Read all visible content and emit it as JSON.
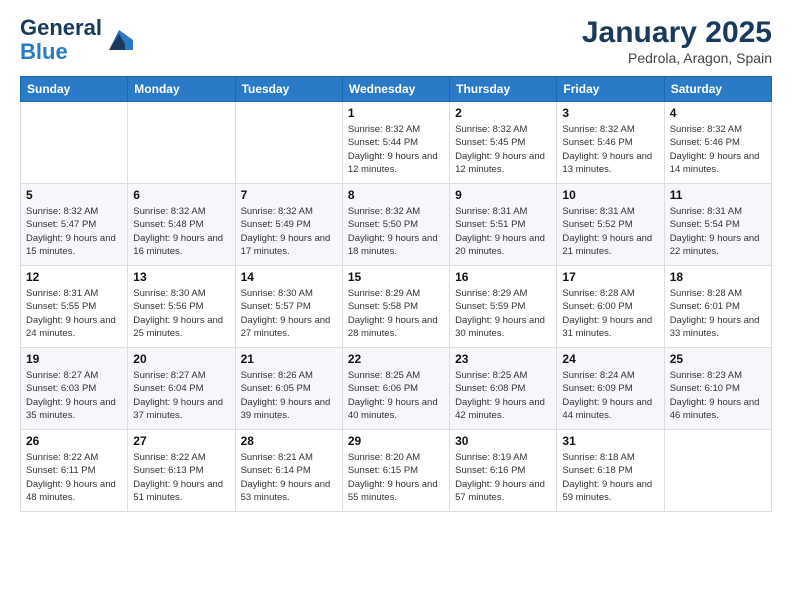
{
  "header": {
    "logo_general": "General",
    "logo_blue": "Blue",
    "month_title": "January 2025",
    "location": "Pedrola, Aragon, Spain"
  },
  "weekdays": [
    "Sunday",
    "Monday",
    "Tuesday",
    "Wednesday",
    "Thursday",
    "Friday",
    "Saturday"
  ],
  "weeks": [
    [
      {
        "day": "",
        "info": ""
      },
      {
        "day": "",
        "info": ""
      },
      {
        "day": "",
        "info": ""
      },
      {
        "day": "1",
        "info": "Sunrise: 8:32 AM\nSunset: 5:44 PM\nDaylight: 9 hours and 12 minutes."
      },
      {
        "day": "2",
        "info": "Sunrise: 8:32 AM\nSunset: 5:45 PM\nDaylight: 9 hours and 12 minutes."
      },
      {
        "day": "3",
        "info": "Sunrise: 8:32 AM\nSunset: 5:46 PM\nDaylight: 9 hours and 13 minutes."
      },
      {
        "day": "4",
        "info": "Sunrise: 8:32 AM\nSunset: 5:46 PM\nDaylight: 9 hours and 14 minutes."
      }
    ],
    [
      {
        "day": "5",
        "info": "Sunrise: 8:32 AM\nSunset: 5:47 PM\nDaylight: 9 hours and 15 minutes."
      },
      {
        "day": "6",
        "info": "Sunrise: 8:32 AM\nSunset: 5:48 PM\nDaylight: 9 hours and 16 minutes."
      },
      {
        "day": "7",
        "info": "Sunrise: 8:32 AM\nSunset: 5:49 PM\nDaylight: 9 hours and 17 minutes."
      },
      {
        "day": "8",
        "info": "Sunrise: 8:32 AM\nSunset: 5:50 PM\nDaylight: 9 hours and 18 minutes."
      },
      {
        "day": "9",
        "info": "Sunrise: 8:31 AM\nSunset: 5:51 PM\nDaylight: 9 hours and 20 minutes."
      },
      {
        "day": "10",
        "info": "Sunrise: 8:31 AM\nSunset: 5:52 PM\nDaylight: 9 hours and 21 minutes."
      },
      {
        "day": "11",
        "info": "Sunrise: 8:31 AM\nSunset: 5:54 PM\nDaylight: 9 hours and 22 minutes."
      }
    ],
    [
      {
        "day": "12",
        "info": "Sunrise: 8:31 AM\nSunset: 5:55 PM\nDaylight: 9 hours and 24 minutes."
      },
      {
        "day": "13",
        "info": "Sunrise: 8:30 AM\nSunset: 5:56 PM\nDaylight: 9 hours and 25 minutes."
      },
      {
        "day": "14",
        "info": "Sunrise: 8:30 AM\nSunset: 5:57 PM\nDaylight: 9 hours and 27 minutes."
      },
      {
        "day": "15",
        "info": "Sunrise: 8:29 AM\nSunset: 5:58 PM\nDaylight: 9 hours and 28 minutes."
      },
      {
        "day": "16",
        "info": "Sunrise: 8:29 AM\nSunset: 5:59 PM\nDaylight: 9 hours and 30 minutes."
      },
      {
        "day": "17",
        "info": "Sunrise: 8:28 AM\nSunset: 6:00 PM\nDaylight: 9 hours and 31 minutes."
      },
      {
        "day": "18",
        "info": "Sunrise: 8:28 AM\nSunset: 6:01 PM\nDaylight: 9 hours and 33 minutes."
      }
    ],
    [
      {
        "day": "19",
        "info": "Sunrise: 8:27 AM\nSunset: 6:03 PM\nDaylight: 9 hours and 35 minutes."
      },
      {
        "day": "20",
        "info": "Sunrise: 8:27 AM\nSunset: 6:04 PM\nDaylight: 9 hours and 37 minutes."
      },
      {
        "day": "21",
        "info": "Sunrise: 8:26 AM\nSunset: 6:05 PM\nDaylight: 9 hours and 39 minutes."
      },
      {
        "day": "22",
        "info": "Sunrise: 8:25 AM\nSunset: 6:06 PM\nDaylight: 9 hours and 40 minutes."
      },
      {
        "day": "23",
        "info": "Sunrise: 8:25 AM\nSunset: 6:08 PM\nDaylight: 9 hours and 42 minutes."
      },
      {
        "day": "24",
        "info": "Sunrise: 8:24 AM\nSunset: 6:09 PM\nDaylight: 9 hours and 44 minutes."
      },
      {
        "day": "25",
        "info": "Sunrise: 8:23 AM\nSunset: 6:10 PM\nDaylight: 9 hours and 46 minutes."
      }
    ],
    [
      {
        "day": "26",
        "info": "Sunrise: 8:22 AM\nSunset: 6:11 PM\nDaylight: 9 hours and 48 minutes."
      },
      {
        "day": "27",
        "info": "Sunrise: 8:22 AM\nSunset: 6:13 PM\nDaylight: 9 hours and 51 minutes."
      },
      {
        "day": "28",
        "info": "Sunrise: 8:21 AM\nSunset: 6:14 PM\nDaylight: 9 hours and 53 minutes."
      },
      {
        "day": "29",
        "info": "Sunrise: 8:20 AM\nSunset: 6:15 PM\nDaylight: 9 hours and 55 minutes."
      },
      {
        "day": "30",
        "info": "Sunrise: 8:19 AM\nSunset: 6:16 PM\nDaylight: 9 hours and 57 minutes."
      },
      {
        "day": "31",
        "info": "Sunrise: 8:18 AM\nSunset: 6:18 PM\nDaylight: 9 hours and 59 minutes."
      },
      {
        "day": "",
        "info": ""
      }
    ]
  ]
}
